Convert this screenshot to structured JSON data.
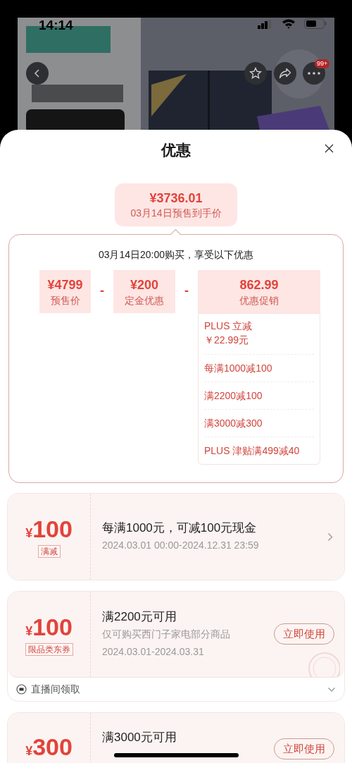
{
  "status_bar": {
    "time": "14:14"
  },
  "product_header": {
    "kind": "picture",
    "more_badge": "99+"
  },
  "sheet": {
    "title": "优惠"
  },
  "final_price": {
    "amount": "¥3736.01",
    "label": "03月14日预售到手价"
  },
  "breakdown": {
    "heading": "03月14日20:00购买，享受以下优惠",
    "terms": [
      {
        "amount": "¥4799",
        "label": "预售价"
      },
      {
        "operator": "-",
        "amount": "¥200",
        "label": "定金优惠"
      },
      {
        "operator": "-",
        "amount": "862.99",
        "label": "优惠促销"
      }
    ],
    "promotions": [
      "PLUS 立减￥22.99元",
      "每满1000减100",
      "满2200减100",
      "满3000减300",
      "PLUS 津贴满499减40"
    ]
  },
  "coupons": [
    {
      "currency": "¥",
      "amount": "100",
      "tag": "满减",
      "title": "每满1000元，可减100元现金",
      "lines": [
        "2024.03.01 00:00-2024.12.31 23:59"
      ],
      "action": {
        "kind": "chevron"
      }
    },
    {
      "currency": "¥",
      "amount": "100",
      "tag": "限品类东券",
      "title": "满2200元可用",
      "lines": [
        "仅可购买西门子家电部分商品",
        "2024.03.01-2024.03.31"
      ],
      "action": {
        "kind": "button",
        "label": "立即使用"
      },
      "stamp": true,
      "footer": "直播间领取"
    },
    {
      "currency": "¥",
      "amount": "300",
      "title": "满3000元可用",
      "action": {
        "kind": "button",
        "label": "立即使用"
      }
    }
  ]
}
